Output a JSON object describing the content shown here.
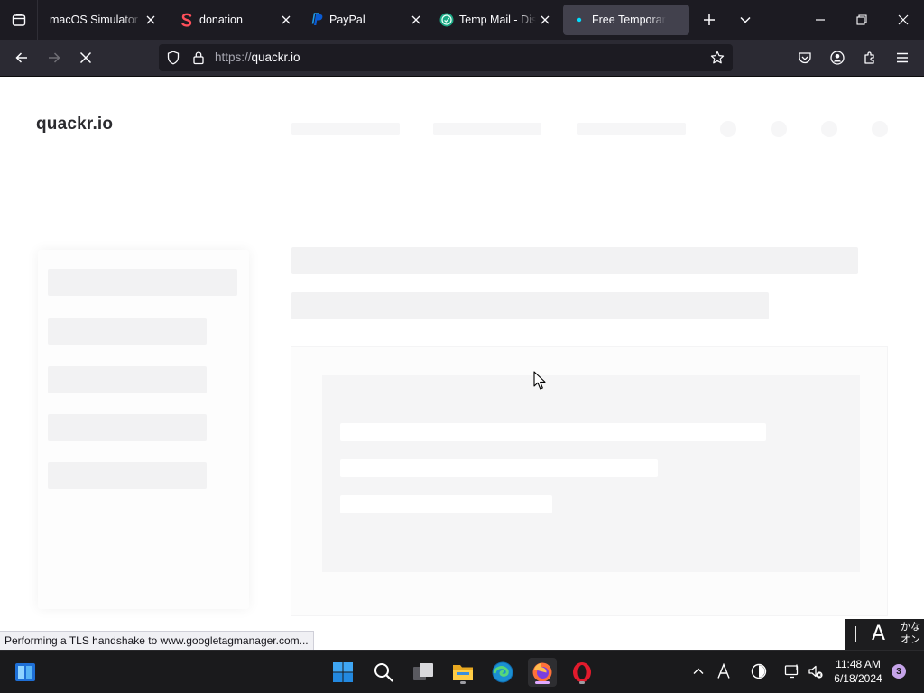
{
  "browser": {
    "tabs": [
      {
        "title": "macOS Simulator Online",
        "favicon": "none",
        "active": false
      },
      {
        "title": "donation",
        "favicon": "s-logo-icon",
        "active": false
      },
      {
        "title": "PayPal",
        "favicon": "paypal-icon",
        "active": false
      },
      {
        "title": "Temp Mail - Disposable Temporary Email",
        "favicon": "temp-mail-icon",
        "active": false
      },
      {
        "title": "Free Temporary Email",
        "favicon": "loading-dot-icon",
        "active": true
      }
    ],
    "url": {
      "protocol": "https://",
      "host": "quackr.io"
    },
    "loading": true
  },
  "page": {
    "logo": "quackr.io",
    "state": "loading skeleton"
  },
  "status": {
    "text": "Performing a TLS handshake to www.googletagmanager.com..."
  },
  "ime": {
    "mode_letter": "A",
    "kana_top": "かな",
    "kana_bottom": "オン"
  },
  "taskbar": {
    "apps": [
      "widgets",
      "start",
      "search",
      "task-view",
      "file-explorer",
      "edge",
      "firefox",
      "opera"
    ],
    "active_app": "firefox"
  },
  "tray": {
    "time": "11:48 AM",
    "date": "6/18/2024",
    "notification_count": "3"
  },
  "colors": {
    "tabstrip": "#1c1b22",
    "navbar": "#2b2a33",
    "active_tab": "#42414d",
    "skeleton": "#f2f2f3",
    "taskbar": "#1a1a1c"
  }
}
